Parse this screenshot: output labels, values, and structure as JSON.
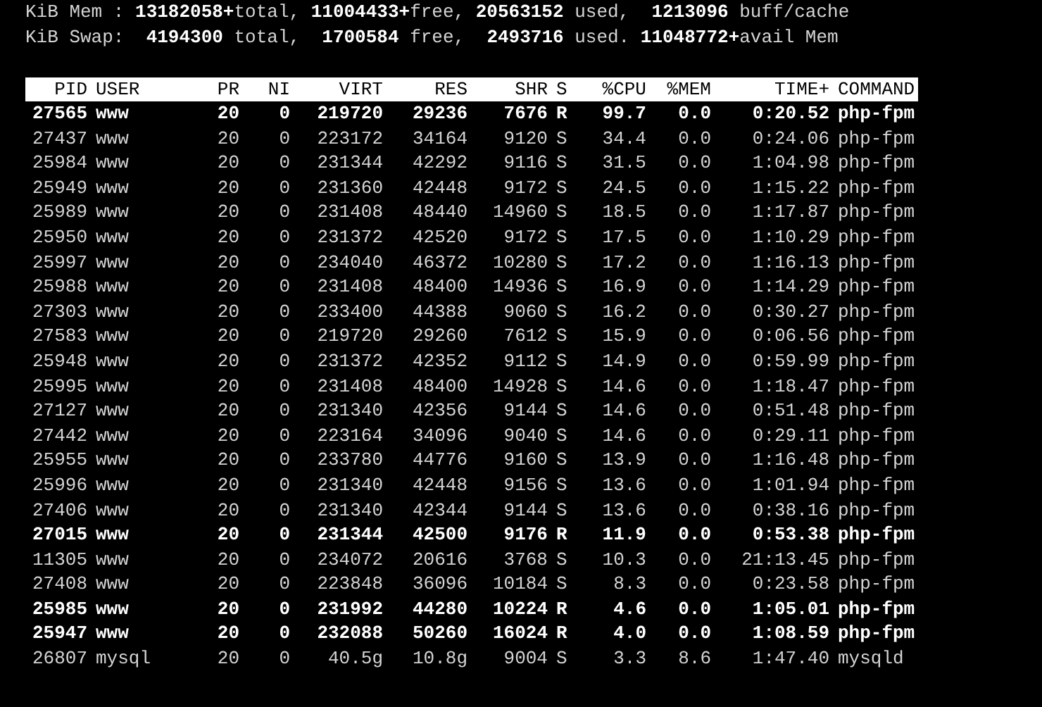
{
  "summary": [
    "KiB Mem : **13182058+**total, **11004433+**free, **20563152** used,  **1213096** buff/cache",
    "KiB Swap:  **4194300** total,  **1700584** free,  **2493716** used. **11048772+**avail Mem"
  ],
  "table": {
    "columns": [
      "PID",
      "USER",
      "PR",
      "NI",
      "VIRT",
      "RES",
      "SHR",
      "S",
      "%CPU",
      "%MEM",
      "TIME+",
      "COMMAND"
    ],
    "rows": [
      {
        "bold": true,
        "cells": [
          "27565",
          "www",
          "20",
          "0",
          "219720",
          "29236",
          "7676",
          "R",
          "99.7",
          "0.0",
          "0:20.52",
          "php-fpm"
        ]
      },
      {
        "bold": false,
        "cells": [
          "27437",
          "www",
          "20",
          "0",
          "223172",
          "34164",
          "9120",
          "S",
          "34.4",
          "0.0",
          "0:24.06",
          "php-fpm"
        ]
      },
      {
        "bold": false,
        "cells": [
          "25984",
          "www",
          "20",
          "0",
          "231344",
          "42292",
          "9116",
          "S",
          "31.5",
          "0.0",
          "1:04.98",
          "php-fpm"
        ]
      },
      {
        "bold": false,
        "cells": [
          "25949",
          "www",
          "20",
          "0",
          "231360",
          "42448",
          "9172",
          "S",
          "24.5",
          "0.0",
          "1:15.22",
          "php-fpm"
        ]
      },
      {
        "bold": false,
        "cells": [
          "25989",
          "www",
          "20",
          "0",
          "231408",
          "48440",
          "14960",
          "S",
          "18.5",
          "0.0",
          "1:17.87",
          "php-fpm"
        ]
      },
      {
        "bold": false,
        "cells": [
          "25950",
          "www",
          "20",
          "0",
          "231372",
          "42520",
          "9172",
          "S",
          "17.5",
          "0.0",
          "1:10.29",
          "php-fpm"
        ]
      },
      {
        "bold": false,
        "cells": [
          "25997",
          "www",
          "20",
          "0",
          "234040",
          "46372",
          "10280",
          "S",
          "17.2",
          "0.0",
          "1:16.13",
          "php-fpm"
        ]
      },
      {
        "bold": false,
        "cells": [
          "25988",
          "www",
          "20",
          "0",
          "231408",
          "48400",
          "14936",
          "S",
          "16.9",
          "0.0",
          "1:14.29",
          "php-fpm"
        ]
      },
      {
        "bold": false,
        "cells": [
          "27303",
          "www",
          "20",
          "0",
          "233400",
          "44388",
          "9060",
          "S",
          "16.2",
          "0.0",
          "0:30.27",
          "php-fpm"
        ]
      },
      {
        "bold": false,
        "cells": [
          "27583",
          "www",
          "20",
          "0",
          "219720",
          "29260",
          "7612",
          "S",
          "15.9",
          "0.0",
          "0:06.56",
          "php-fpm"
        ]
      },
      {
        "bold": false,
        "cells": [
          "25948",
          "www",
          "20",
          "0",
          "231372",
          "42352",
          "9112",
          "S",
          "14.9",
          "0.0",
          "0:59.99",
          "php-fpm"
        ]
      },
      {
        "bold": false,
        "cells": [
          "25995",
          "www",
          "20",
          "0",
          "231408",
          "48400",
          "14928",
          "S",
          "14.6",
          "0.0",
          "1:18.47",
          "php-fpm"
        ]
      },
      {
        "bold": false,
        "cells": [
          "27127",
          "www",
          "20",
          "0",
          "231340",
          "42356",
          "9144",
          "S",
          "14.6",
          "0.0",
          "0:51.48",
          "php-fpm"
        ]
      },
      {
        "bold": false,
        "cells": [
          "27442",
          "www",
          "20",
          "0",
          "223164",
          "34096",
          "9040",
          "S",
          "14.6",
          "0.0",
          "0:29.11",
          "php-fpm"
        ]
      },
      {
        "bold": false,
        "cells": [
          "25955",
          "www",
          "20",
          "0",
          "233780",
          "44776",
          "9160",
          "S",
          "13.9",
          "0.0",
          "1:16.48",
          "php-fpm"
        ]
      },
      {
        "bold": false,
        "cells": [
          "25996",
          "www",
          "20",
          "0",
          "231340",
          "42448",
          "9156",
          "S",
          "13.6",
          "0.0",
          "1:01.94",
          "php-fpm"
        ]
      },
      {
        "bold": false,
        "cells": [
          "27406",
          "www",
          "20",
          "0",
          "231340",
          "42344",
          "9144",
          "S",
          "13.6",
          "0.0",
          "0:38.16",
          "php-fpm"
        ]
      },
      {
        "bold": true,
        "cells": [
          "27015",
          "www",
          "20",
          "0",
          "231344",
          "42500",
          "9176",
          "R",
          "11.9",
          "0.0",
          "0:53.38",
          "php-fpm"
        ]
      },
      {
        "bold": false,
        "cells": [
          "11305",
          "www",
          "20",
          "0",
          "234072",
          "20616",
          "3768",
          "S",
          "10.3",
          "0.0",
          "21:13.45",
          "php-fpm"
        ]
      },
      {
        "bold": false,
        "cells": [
          "27408",
          "www",
          "20",
          "0",
          "223848",
          "36096",
          "10184",
          "S",
          "8.3",
          "0.0",
          "0:23.58",
          "php-fpm"
        ]
      },
      {
        "bold": true,
        "cells": [
          "25985",
          "www",
          "20",
          "0",
          "231992",
          "44280",
          "10224",
          "R",
          "4.6",
          "0.0",
          "1:05.01",
          "php-fpm"
        ]
      },
      {
        "bold": true,
        "cells": [
          "25947",
          "www",
          "20",
          "0",
          "232088",
          "50260",
          "16024",
          "R",
          "4.0",
          "0.0",
          "1:08.59",
          "php-fpm"
        ]
      },
      {
        "bold": false,
        "cells": [
          "26807",
          "mysql",
          "20",
          "0",
          "40.5g",
          "10.8g",
          "9004",
          "S",
          "3.3",
          "8.6",
          "1:47.40",
          "mysqld"
        ]
      }
    ]
  }
}
